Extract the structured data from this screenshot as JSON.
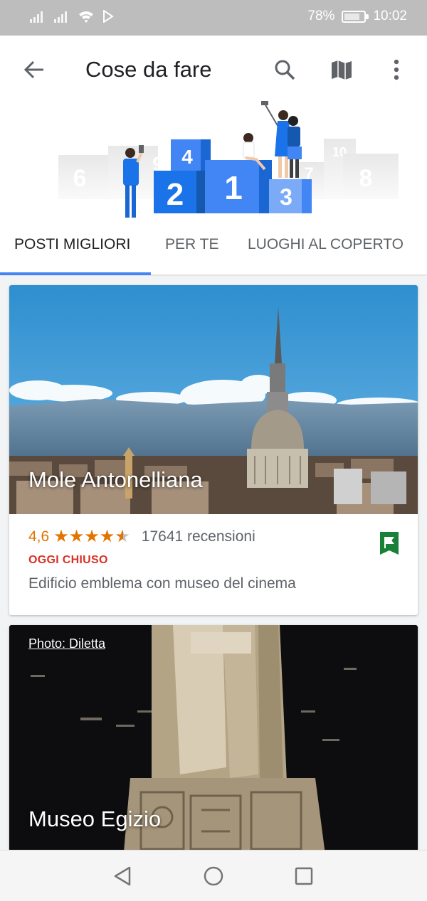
{
  "status_bar": {
    "battery": "78%",
    "time": "10:02",
    "battery_level": 0.78
  },
  "app_bar": {
    "title": "Cose da fare",
    "icons": [
      "back-arrow-icon",
      "search-icon",
      "map-icon",
      "more-vert-icon"
    ]
  },
  "illustration": {
    "podium_numbers": [
      "1",
      "2",
      "3",
      "4",
      "6",
      "8",
      "10",
      "7",
      "9"
    ]
  },
  "tabs": [
    {
      "label": "POSTI MIGLIORI",
      "active": true
    },
    {
      "label": "PER TE",
      "active": false
    },
    {
      "label": "LUOGHI AL COPERTO",
      "active": false
    }
  ],
  "places": [
    {
      "name": "Mole Antonelliana",
      "rating": "4,6",
      "rating_value": 4.6,
      "reviews": "17641 recensioni",
      "status": "OGGI CHIUSO",
      "description": "Edificio emblema con museo del cinema",
      "saved_icon": "flag-icon"
    },
    {
      "name": "Museo Egizio",
      "photo_credit": "Photo: Diletta"
    }
  ],
  "colors": {
    "accent": "#4285f4",
    "rating": "#e37400",
    "closed": "#d93025",
    "saved": "#188038"
  },
  "nav_bar": {
    "icons": [
      "back-triangle-icon",
      "home-circle-icon",
      "recents-square-icon"
    ]
  }
}
